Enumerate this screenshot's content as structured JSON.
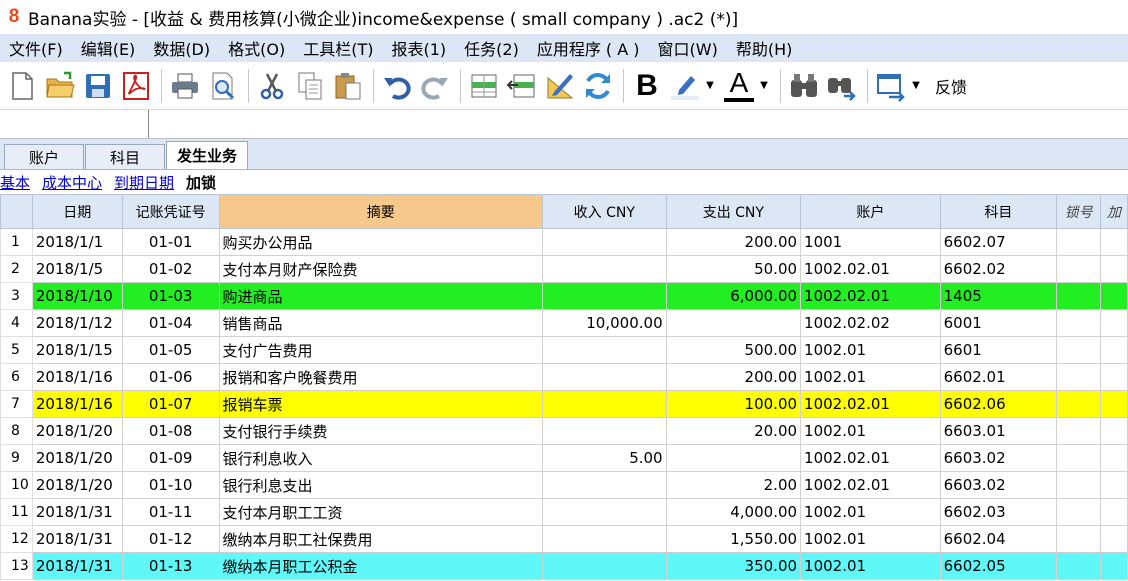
{
  "window": {
    "title": "Banana实验 - [收益 & 费用核算(小微企业)income&expense ( small company ) .ac2 (*)]",
    "logo_text": "8"
  },
  "menu": [
    "文件(F)",
    "编辑(E)",
    "数据(D)",
    "格式(O)",
    "工具栏(T)",
    "报表(1)",
    "任务(2)",
    "应用程序 ( A )",
    "窗口(W)",
    "帮助(H)"
  ],
  "toolbar": {
    "feedback_label": "反馈",
    "bold_glyph": "B",
    "font_color_glyph": "A"
  },
  "tabs": [
    "账户",
    "科目",
    "发生业务"
  ],
  "views": [
    "基本",
    "成本中心",
    "到期日期",
    "加锁"
  ],
  "table": {
    "headers": [
      "日期",
      "记账凭证号",
      "摘要",
      "收入 CNY",
      "支出 CNY",
      "账户",
      "科目",
      "锁号",
      "加"
    ],
    "rows": [
      {
        "n": "1",
        "date": "2018/1/1",
        "doc": "01-01",
        "desc": "购买办公用品",
        "income": "",
        "expense": "200.00",
        "account": "1001",
        "subject": "6602.07",
        "hl": ""
      },
      {
        "n": "2",
        "date": "2018/1/5",
        "doc": "01-02",
        "desc": "支付本月财产保险费",
        "income": "",
        "expense": "50.00",
        "account": "1002.02.01",
        "subject": "6602.02",
        "hl": ""
      },
      {
        "n": "3",
        "date": "2018/1/10",
        "doc": "01-03",
        "desc": "购进商品",
        "income": "",
        "expense": "6,000.00",
        "account": "1002.02.01",
        "subject": "1405",
        "hl": "green"
      },
      {
        "n": "4",
        "date": "2018/1/12",
        "doc": "01-04",
        "desc": "销售商品",
        "income": "10,000.00",
        "expense": "",
        "account": "1002.02.02",
        "subject": "6001",
        "hl": ""
      },
      {
        "n": "5",
        "date": "2018/1/15",
        "doc": "01-05",
        "desc": "支付广告费用",
        "income": "",
        "expense": "500.00",
        "account": "1002.01",
        "subject": "6601",
        "hl": ""
      },
      {
        "n": "6",
        "date": "2018/1/16",
        "doc": "01-06",
        "desc": "报销和客户晚餐费用",
        "income": "",
        "expense": "200.00",
        "account": "1002.01",
        "subject": "6602.01",
        "hl": ""
      },
      {
        "n": "7",
        "date": "2018/1/16",
        "doc": "01-07",
        "desc": "报销车票",
        "income": "",
        "expense": "100.00",
        "account": "1002.02.01",
        "subject": "6602.06",
        "hl": "yellow"
      },
      {
        "n": "8",
        "date": "2018/1/20",
        "doc": "01-08",
        "desc": "支付银行手续费",
        "income": "",
        "expense": "20.00",
        "account": "1002.01",
        "subject": "6603.01",
        "hl": ""
      },
      {
        "n": "9",
        "date": "2018/1/20",
        "doc": "01-09",
        "desc": "银行利息收入",
        "income": "5.00",
        "expense": "",
        "account": "1002.02.01",
        "subject": "6603.02",
        "hl": ""
      },
      {
        "n": "10",
        "date": "2018/1/20",
        "doc": "01-10",
        "desc": "银行利息支出",
        "income": "",
        "expense": "2.00",
        "account": "1002.02.01",
        "subject": "6603.02",
        "hl": ""
      },
      {
        "n": "11",
        "date": "2018/1/31",
        "doc": "01-11",
        "desc": "支付本月职工工资",
        "income": "",
        "expense": "4,000.00",
        "account": "1002.01",
        "subject": "6602.03",
        "hl": ""
      },
      {
        "n": "12",
        "date": "2018/1/31",
        "doc": "01-12",
        "desc": "缴纳本月职工社保费用",
        "income": "",
        "expense": "1,550.00",
        "account": "1002.01",
        "subject": "6602.04",
        "hl": ""
      },
      {
        "n": "13",
        "date": "2018/1/31",
        "doc": "01-13",
        "desc": "缴纳本月职工公积金",
        "income": "",
        "expense": "350.00",
        "account": "1002.01",
        "subject": "6602.05",
        "hl": "cyan"
      }
    ]
  }
}
